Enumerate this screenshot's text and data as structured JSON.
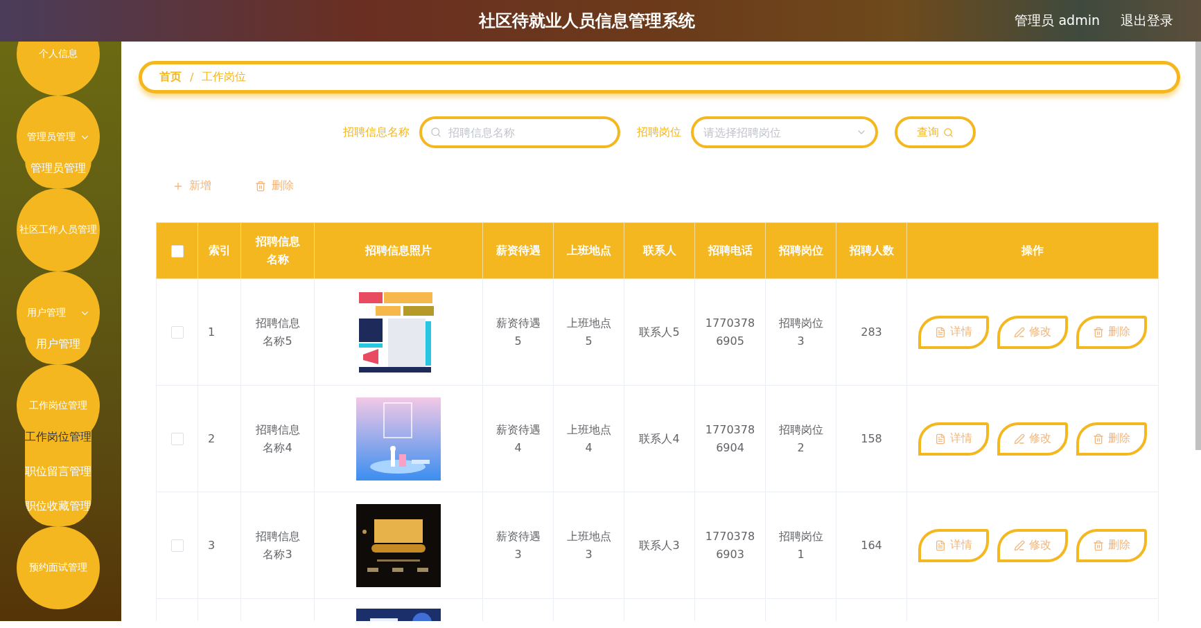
{
  "header": {
    "title": "社区待就业人员信息管理系统",
    "user": "管理员 admin",
    "logout": "退出登录"
  },
  "sidebar": {
    "items": [
      {
        "label": "个人信息",
        "caret": false
      },
      {
        "label": "管理员管理",
        "caret": true,
        "children": [
          {
            "label": "管理员管理",
            "selected": false
          }
        ]
      },
      {
        "label": "社区工作人员管理",
        "caret": false
      },
      {
        "label": "用户管理",
        "caret": true,
        "children": [
          {
            "label": "用户管理",
            "selected": false
          }
        ]
      },
      {
        "label": "工作岗位管理",
        "caret": false,
        "children": [
          {
            "label": "工作岗位管理",
            "selected": true
          },
          {
            "label": "职位留言管理",
            "selected": false
          },
          {
            "label": "职位收藏管理",
            "selected": false
          }
        ]
      },
      {
        "label": "预约面试管理",
        "caret": false
      }
    ]
  },
  "breadcrumb": [
    "首页",
    "/",
    "工作岗位"
  ],
  "search": {
    "fields": [
      {
        "kind": "text",
        "label": "招聘信息名称",
        "placeholder": "招聘信息名称"
      },
      {
        "kind": "select",
        "label": "招聘岗位",
        "placeholder": "请选择招聘岗位"
      }
    ],
    "button": "查询"
  },
  "actions": [
    {
      "kind": "add",
      "label": "新增"
    },
    {
      "kind": "delete",
      "label": "删除"
    }
  ],
  "table": {
    "select_all": {
      "checked": false
    },
    "columns": [
      "索引",
      "招聘信息名称",
      "招聘信息照片",
      "薪资待遇",
      "上班地点",
      "联系人",
      "招聘电话",
      "招聘岗位",
      "招聘人数",
      "操作"
    ],
    "rows": [
      {
        "checked": false,
        "index": "1",
        "name": "招聘信息名称5",
        "salary": "薪资待遇5",
        "location": "上班地点5",
        "contact": "联系人5",
        "phone": "17703786905",
        "post": "招聘岗位3",
        "count": "283",
        "actions": [
          {
            "kind": "detail",
            "label": "详情"
          },
          {
            "kind": "edit",
            "label": "修改"
          },
          {
            "kind": "delete",
            "label": "删除"
          }
        ]
      },
      {
        "checked": false,
        "index": "2",
        "name": "招聘信息名称4",
        "salary": "薪资待遇4",
        "location": "上班地点4",
        "contact": "联系人4",
        "phone": "17703786904",
        "post": "招聘岗位2",
        "count": "158",
        "actions": [
          {
            "kind": "detail",
            "label": "详情"
          },
          {
            "kind": "edit",
            "label": "修改"
          },
          {
            "kind": "delete",
            "label": "删除"
          }
        ]
      },
      {
        "checked": false,
        "index": "3",
        "name": "招聘信息名称3",
        "salary": "薪资待遇3",
        "location": "上班地点3",
        "contact": "联系人3",
        "phone": "17703786903",
        "post": "招聘岗位1",
        "count": "164",
        "actions": [
          {
            "kind": "detail",
            "label": "详情"
          },
          {
            "kind": "edit",
            "label": "修改"
          },
          {
            "kind": "delete",
            "label": "删除"
          }
        ]
      }
    ]
  }
}
